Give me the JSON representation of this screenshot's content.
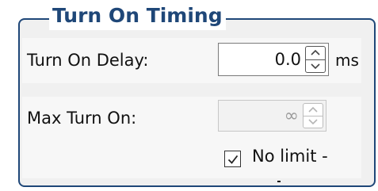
{
  "group": {
    "title": "Turn On Timing",
    "accent_color": "#1f4778"
  },
  "turn_on_delay": {
    "label": "Turn On Delay:",
    "value": "0.0",
    "unit": "ms",
    "up_icon": "chevron-up-icon",
    "down_icon": "chevron-down-icon"
  },
  "max_turn_on": {
    "label": "Max Turn On:",
    "value": "∞",
    "enabled": false,
    "up_icon": "chevron-up-icon",
    "down_icon": "chevron-down-icon"
  },
  "no_limit": {
    "label": "No limit -",
    "checked": true,
    "check_icon": "checkmark-icon"
  }
}
